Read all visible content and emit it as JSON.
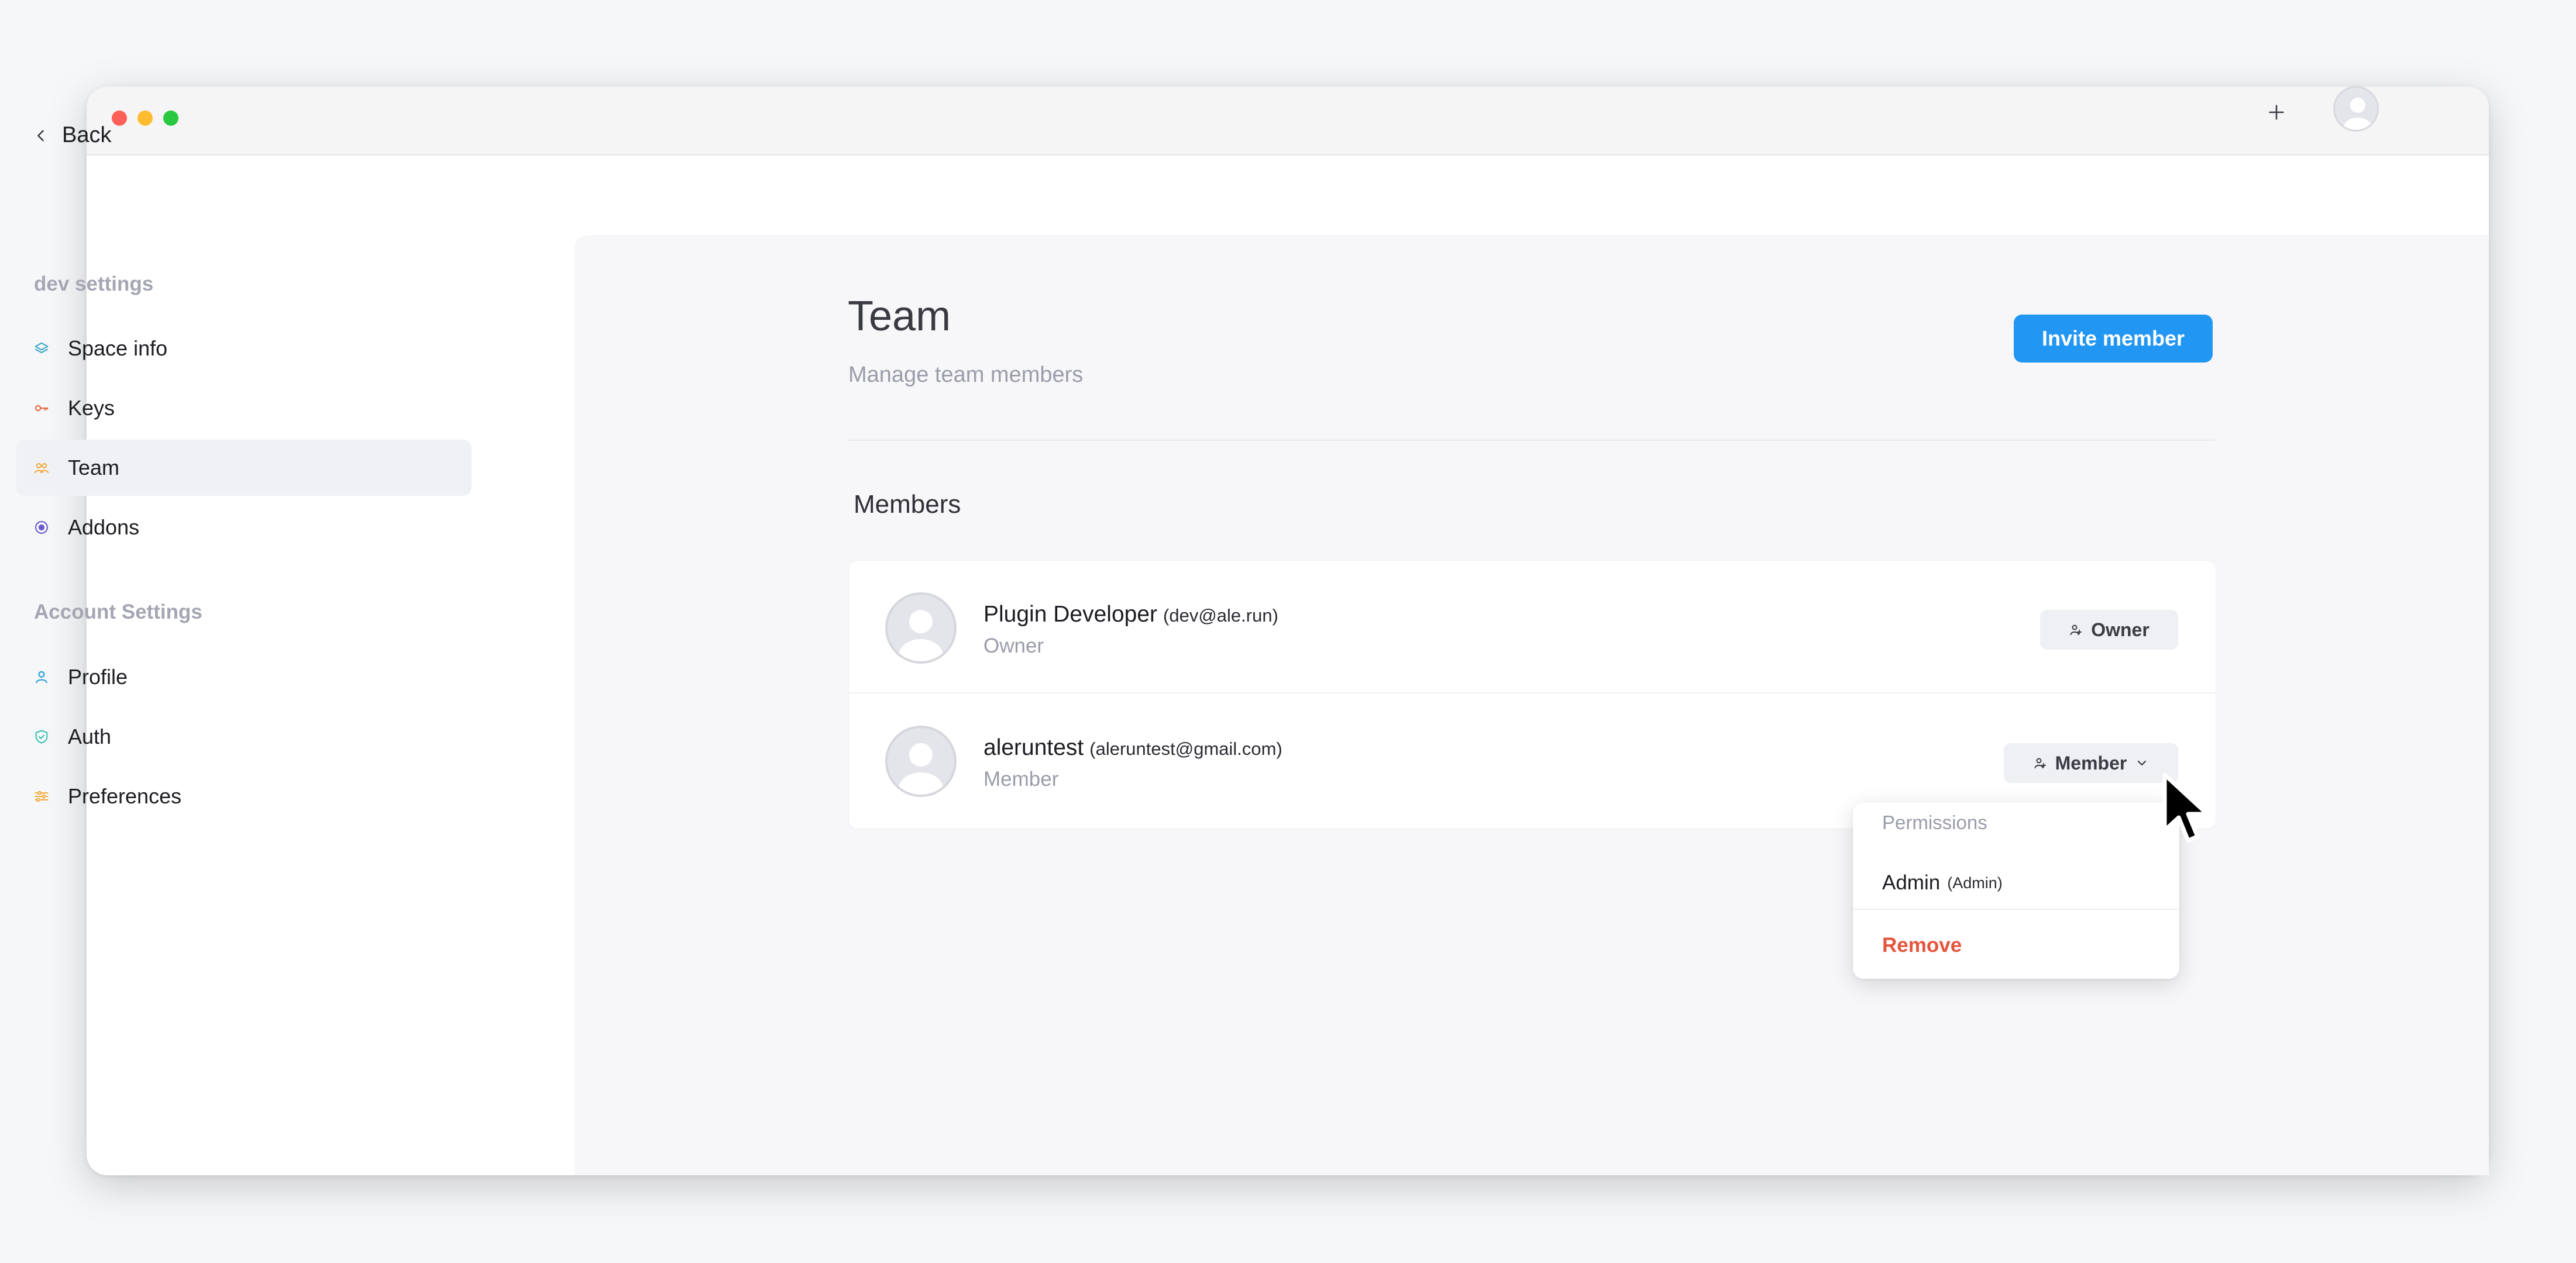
{
  "sidebar": {
    "back_label": "Back",
    "section_dev": "dev settings",
    "dev_items": [
      {
        "label": "Space info",
        "icon": "layers-icon"
      },
      {
        "label": "Keys",
        "icon": "key-icon"
      },
      {
        "label": "Team",
        "icon": "team-icon",
        "active": true
      },
      {
        "label": "Addons",
        "icon": "addon-icon"
      }
    ],
    "section_account": "Account Settings",
    "account_items": [
      {
        "label": "Profile",
        "icon": "user-icon"
      },
      {
        "label": "Auth",
        "icon": "shield-icon"
      },
      {
        "label": "Preferences",
        "icon": "sliders-icon"
      }
    ]
  },
  "page": {
    "title": "Team",
    "subtitle": "Manage team members",
    "invite_label": "Invite member",
    "members_heading": "Members"
  },
  "members": [
    {
      "name": "Plugin Developer",
      "email": "(dev@ale.run)",
      "role": "Owner",
      "button": "Owner"
    },
    {
      "name": "aleruntest",
      "email": "(aleruntest@gmail.com)",
      "role": "Member",
      "button": "Member"
    }
  ],
  "dropdown": {
    "label": "Permissions",
    "option_name": "Admin",
    "option_tag": "(Admin)",
    "remove_label": "Remove"
  },
  "colors": {
    "accent": "#2296f3",
    "danger": "#e5553d",
    "muted": "#9a9caa"
  }
}
